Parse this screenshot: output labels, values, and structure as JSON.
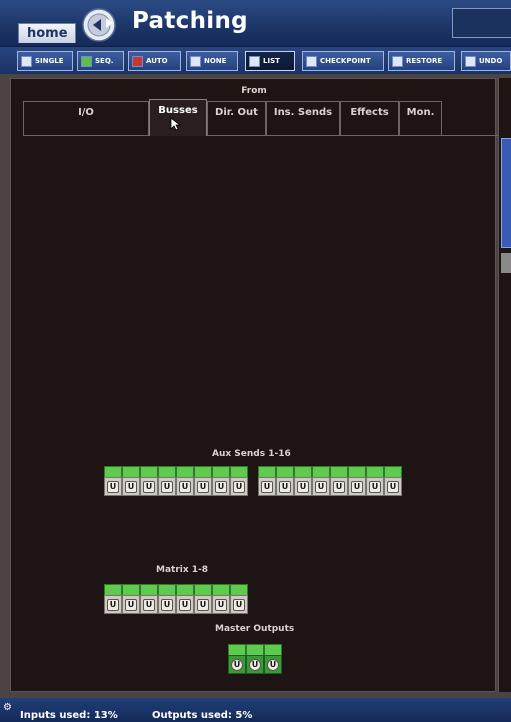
{
  "header": {
    "home_label": "home",
    "title": "Patching"
  },
  "toolbar": {
    "buttons": [
      {
        "label": "SINGLE",
        "icon": "single-patch-icon"
      },
      {
        "label": "SEQ.",
        "icon": "sequence-patch-icon"
      },
      {
        "label": "AUTO",
        "icon": "auto-patch-icon"
      },
      {
        "label": "NONE",
        "icon": "no-patch-icon"
      },
      {
        "label": "LIST",
        "icon": "list-icon"
      },
      {
        "label": "CHECKPOINT",
        "icon": "checkpoint-icon"
      },
      {
        "label": "RESTORE",
        "icon": "restore-icon"
      },
      {
        "label": "UNDO",
        "icon": "undo-icon"
      }
    ],
    "active": "LIST"
  },
  "from_label": "From",
  "tabs": [
    {
      "label": "I/O"
    },
    {
      "label": "Busses"
    },
    {
      "label": "Dir. Out"
    },
    {
      "label": "Ins. Sends"
    },
    {
      "label": "Effects"
    },
    {
      "label": "Mon."
    }
  ],
  "active_tab": "Busses",
  "sections": {
    "aux": {
      "title": "Aux Sends 1-16",
      "port_count": 16,
      "port_glyph": "U"
    },
    "matrix": {
      "title": "Matrix 1-8",
      "port_count": 8,
      "port_glyph": "U"
    },
    "master": {
      "title": "Master Outputs",
      "port_count": 3,
      "port_glyph": "U"
    }
  },
  "status": {
    "inputs_used": "Inputs used: 13%",
    "outputs_used": "Outputs used: 5%"
  },
  "colors": {
    "title_bar": "#1c3566",
    "panel_background": "#1e1413",
    "port_green": "#5ecb4f",
    "port_grey": "#cfcac3"
  }
}
